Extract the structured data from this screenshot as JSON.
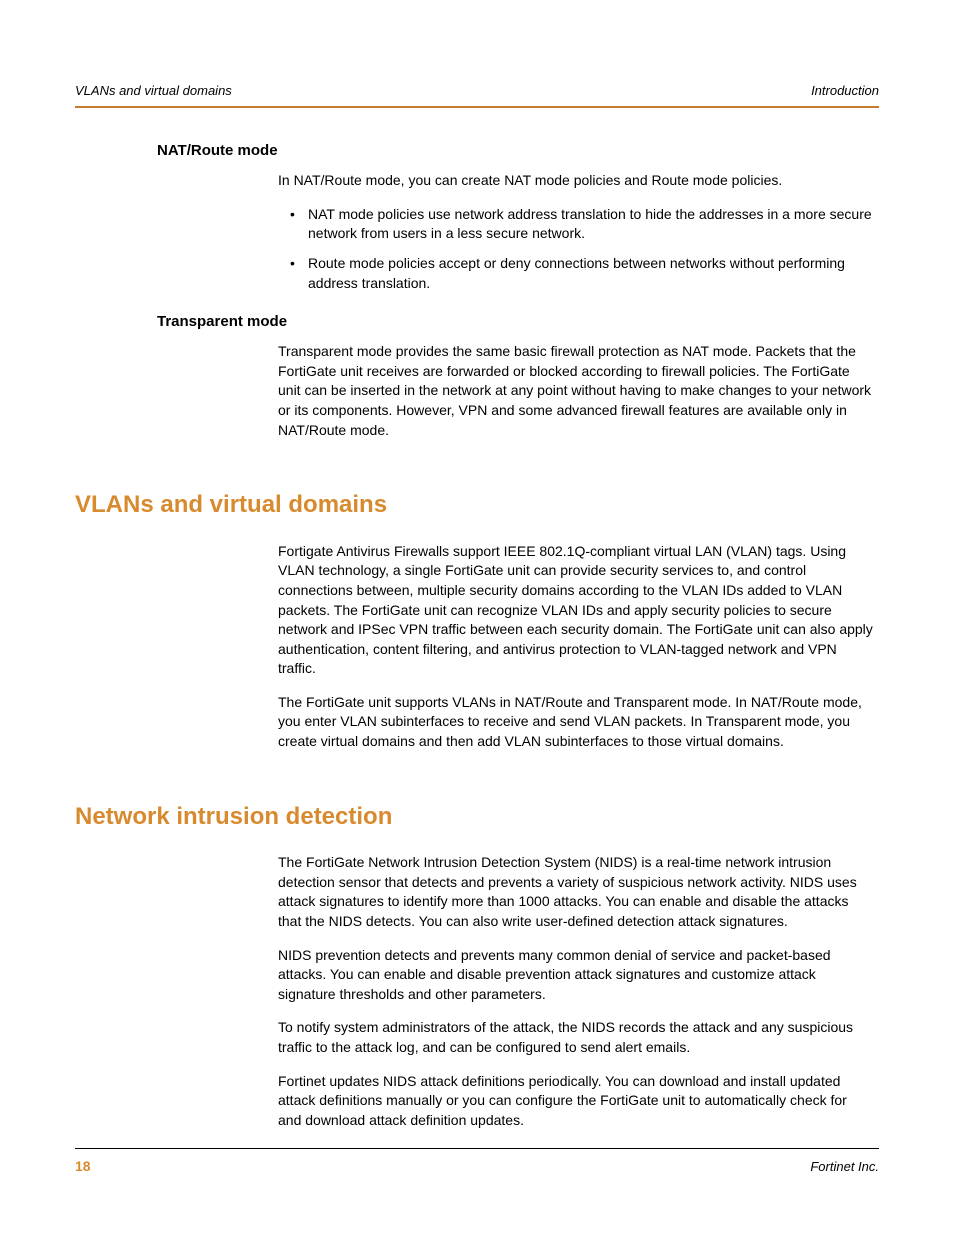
{
  "header": {
    "left": "VLANs and virtual domains",
    "right": "Introduction"
  },
  "sections": {
    "natRoute": {
      "heading": "NAT/Route mode",
      "intro": "In NAT/Route mode, you can create NAT mode policies and Route mode policies.",
      "bullets": [
        "NAT mode policies use network address translation to hide the addresses in a more secure network from users in a less secure network.",
        "Route mode policies accept or deny connections between networks without performing address translation."
      ]
    },
    "transparent": {
      "heading": "Transparent mode",
      "p1": "Transparent mode provides the same basic firewall protection as NAT mode. Packets that the FortiGate unit receives are forwarded or blocked according to firewall policies. The FortiGate unit can be inserted in the network at any point without having to make changes to your network or its components. However, VPN and some advanced firewall features are available only in NAT/Route mode."
    },
    "vlans": {
      "heading": "VLANs and virtual domains",
      "p1": "Fortigate Antivirus Firewalls support IEEE 802.1Q-compliant virtual LAN (VLAN) tags. Using VLAN technology, a single FortiGate unit can provide security services to, and control connections between, multiple security domains according to the VLAN IDs added to VLAN packets. The FortiGate unit can recognize VLAN IDs and apply security policies to secure network and IPSec VPN traffic between each security domain. The FortiGate unit can also apply authentication, content filtering, and antivirus protection to VLAN-tagged network and VPN traffic.",
      "p2": "The FortiGate unit supports VLANs in NAT/Route and Transparent mode. In NAT/Route mode, you enter VLAN subinterfaces to receive and send VLAN packets. In Transparent mode, you create virtual domains and then add VLAN subinterfaces to those virtual domains."
    },
    "nids": {
      "heading": "Network intrusion detection",
      "p1": "The FortiGate Network Intrusion Detection System (NIDS) is a real-time network intrusion detection sensor that detects and prevents a variety of suspicious network activity. NIDS uses attack signatures to identify more than 1000 attacks. You can enable and disable the attacks that the NIDS detects. You can also write user-defined detection attack signatures.",
      "p2": "NIDS prevention detects and prevents many common denial of service and packet-based attacks. You can enable and disable prevention attack signatures and customize attack signature thresholds and other parameters.",
      "p3": "To notify system administrators of the attack, the NIDS records the attack and any suspicious traffic to the attack log, and can be configured to send alert emails.",
      "p4": "Fortinet updates NIDS attack definitions periodically. You can download and install updated attack definitions manually or you can configure the FortiGate unit to automatically check for and download attack definition updates."
    }
  },
  "footer": {
    "page": "18",
    "company": "Fortinet Inc."
  }
}
